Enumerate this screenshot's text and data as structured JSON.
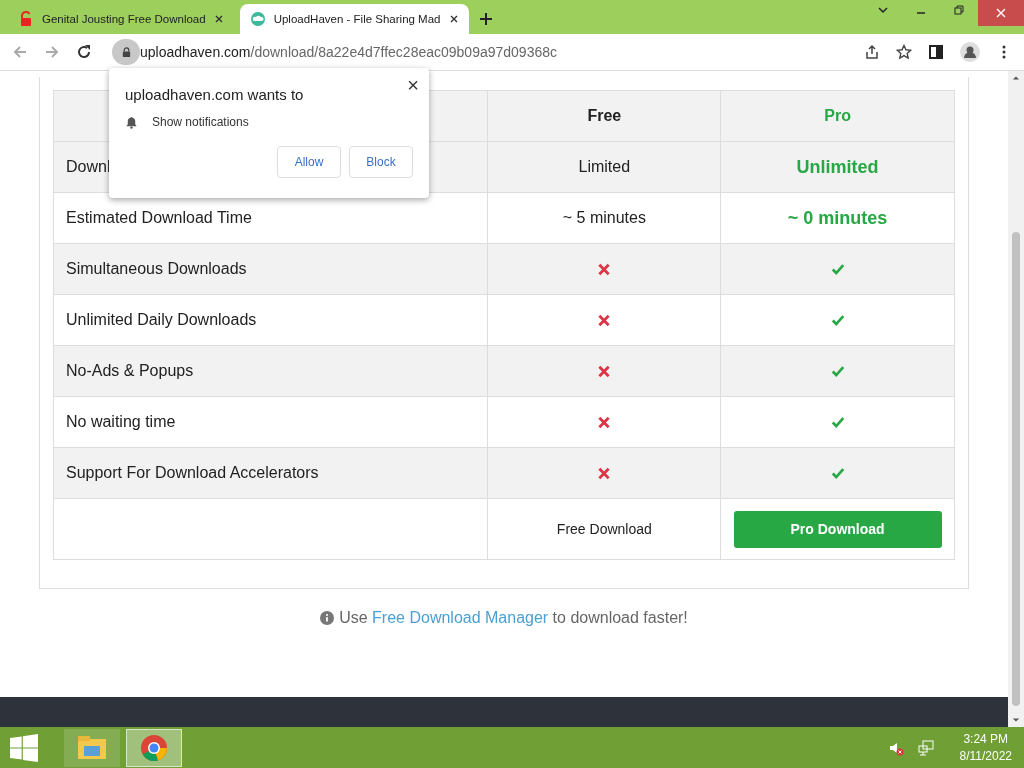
{
  "browser": {
    "tabs": [
      {
        "title": "Genital Jousting Free Download",
        "selected": false
      },
      {
        "title": "UploadHaven - File Sharing Mad",
        "selected": true
      }
    ],
    "url_host": "uploadhaven.com",
    "url_path": "/download/8a22e4d7ffec28eac09b09a97d09368c"
  },
  "permission_popup": {
    "title": "uploadhaven.com wants to",
    "request": "Show notifications",
    "buttons": [
      "Allow",
      "Block"
    ],
    "close": "×"
  },
  "comparison_table": {
    "columns": [
      "Free",
      "Pro"
    ],
    "rows": [
      {
        "feature": "Downl",
        "free": {
          "kind": "text",
          "text": "Limited"
        },
        "pro": {
          "kind": "text",
          "text": "Unlimited"
        }
      },
      {
        "feature": "Estimated Download Time",
        "free": {
          "kind": "text",
          "text": "~ 5 minutes"
        },
        "pro": {
          "kind": "text",
          "text": "~ 0 minutes"
        }
      },
      {
        "feature": "Simultaneous Downloads",
        "free": {
          "kind": "mark",
          "available": false
        },
        "pro": {
          "kind": "mark",
          "available": true
        }
      },
      {
        "feature": "Unlimited Daily Downloads",
        "free": {
          "kind": "mark",
          "available": false
        },
        "pro": {
          "kind": "mark",
          "available": true
        }
      },
      {
        "feature": "No-Ads & Popups",
        "free": {
          "kind": "mark",
          "available": false
        },
        "pro": {
          "kind": "mark",
          "available": true
        }
      },
      {
        "feature": "No waiting time",
        "free": {
          "kind": "mark",
          "available": false
        },
        "pro": {
          "kind": "mark",
          "available": true
        }
      },
      {
        "feature": "Support For Download Accelerators",
        "free": {
          "kind": "mark",
          "available": false
        },
        "pro": {
          "kind": "mark",
          "available": true
        }
      }
    ],
    "free_action": "Free Download",
    "pro_action": "Pro Download"
  },
  "tip": {
    "prefix": "Use",
    "link": "Free Download Manager",
    "suffix": "to download faster!"
  },
  "taskbar": {
    "apps": [
      {
        "kind": "explorer",
        "selected": false
      },
      {
        "kind": "chrome",
        "selected": true
      }
    ],
    "time": "3:24 PM",
    "date": "8/11/2022"
  }
}
